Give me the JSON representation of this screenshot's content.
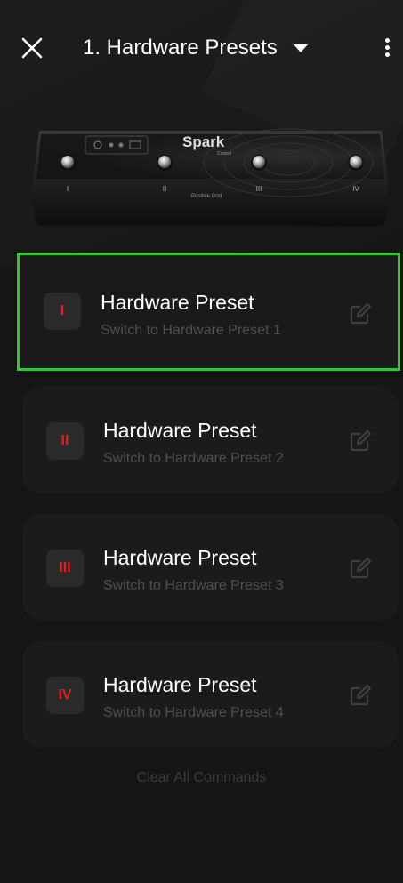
{
  "header": {
    "title": "1. Hardware Presets"
  },
  "device": {
    "brand": "Spark",
    "brand_sub": "Control",
    "maker": "Positive Grid",
    "switch_labels": [
      "I",
      "II",
      "III",
      "IV"
    ]
  },
  "presets": [
    {
      "badge": "I",
      "title": "Hardware Preset",
      "subtitle": "Switch to Hardware Preset 1"
    },
    {
      "badge": "II",
      "title": "Hardware Preset",
      "subtitle": "Switch to Hardware Preset 2"
    },
    {
      "badge": "III",
      "title": "Hardware Preset",
      "subtitle": "Switch to Hardware Preset 3"
    },
    {
      "badge": "IV",
      "title": "Hardware Preset",
      "subtitle": "Switch to Hardware Preset 4"
    }
  ],
  "clear_label": "Clear All Commands",
  "colors": {
    "background": "#151515",
    "card": "#1b1b1b",
    "badge_text": "#e02020",
    "selection_outline": "#3dbd3d",
    "muted_text": "#4f4f4f"
  },
  "icons": [
    "close-icon",
    "caret-down-icon",
    "more-vertical-icon",
    "edit-icon"
  ]
}
